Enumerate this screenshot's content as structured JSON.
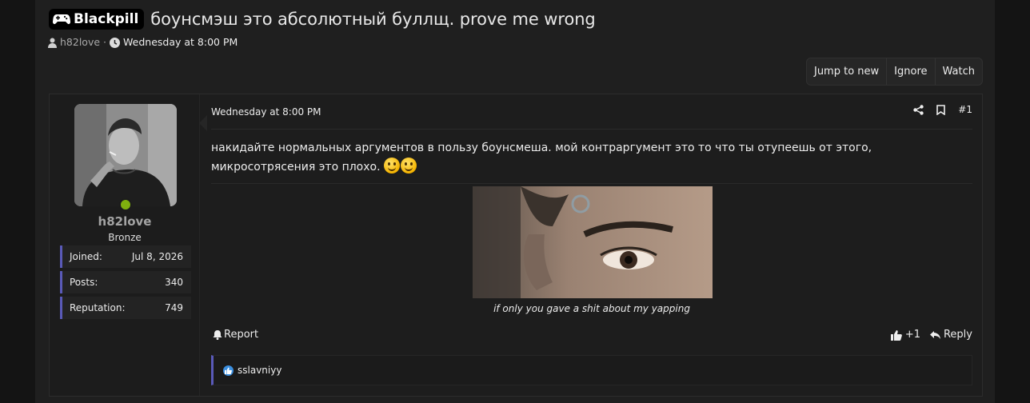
{
  "thread": {
    "prefix": "Blackpill",
    "title": "боунсмэш это абсолютный буллщ. prove me wrong",
    "author": "h82love",
    "separator": "·",
    "date": "Wednesday at 8:00 PM",
    "prefix_icon": "gamepad-icon"
  },
  "actions": {
    "jump_to_new": "Jump to new",
    "ignore": "Ignore",
    "watch": "Watch"
  },
  "user": {
    "name": "h82love",
    "title": "Bronze",
    "online": true,
    "stats": [
      {
        "label": "Joined:",
        "value": "Jul 8, 2026"
      },
      {
        "label": "Posts:",
        "value": "340"
      },
      {
        "label": "Reputation:",
        "value": "749"
      }
    ]
  },
  "post": {
    "date": "Wednesday at 8:00 PM",
    "number": "#1",
    "text": "накидайте нормальных аргументов в пользу боунсмеша. мой контраргумент это то что ты отупеешь от этого, микросотрясения это плохо.",
    "smiley_count": 2,
    "image_caption": "if only you gave a shit about my yapping",
    "report_label": "Report",
    "like_count": "+1",
    "reply_label": "Reply",
    "reacted_by": "sslavniyy"
  },
  "colors": {
    "background": "#141414",
    "page": "#1f1f1f",
    "accent_border": "#5a5ab8",
    "online": "#7fb00f",
    "like": "#3b8fe0"
  }
}
